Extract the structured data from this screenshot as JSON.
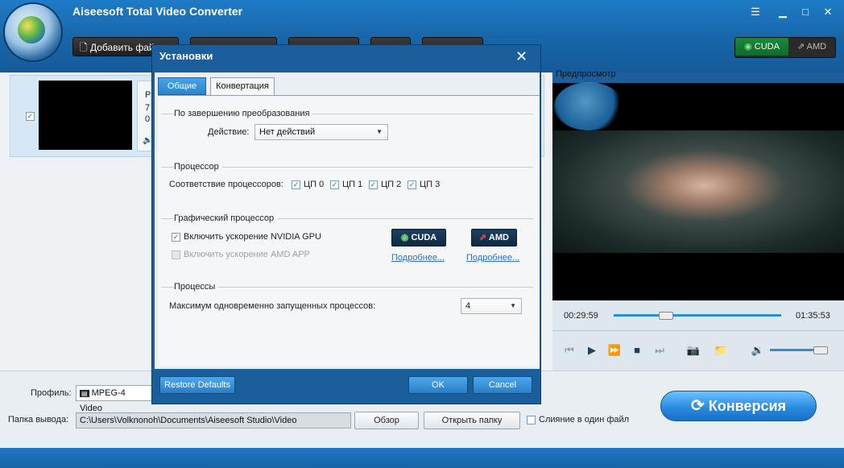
{
  "app": {
    "title": "Aiseesoft Total Video Converter"
  },
  "toolbar": {
    "add_file_label": "Добавить файл",
    "gpu_cuda": "CUDA",
    "gpu_amd": "AMD"
  },
  "file_item": {
    "line1": "P",
    "line2": "7",
    "line3": "0"
  },
  "preview": {
    "label": "Предпросмотр",
    "time_current": "00:29:59",
    "time_total": "01:35:53"
  },
  "bottom": {
    "profile_label": "Профиль:",
    "profile_value": "MPEG-4 Video",
    "output_label": "Папка вывода:",
    "output_path": "C:\\Users\\Volknonoh\\Documents\\Aiseesoft Studio\\Video",
    "browse_label": "Обзор",
    "open_folder_label": "Открыть папку",
    "merge_label": "Слияние в один файл",
    "convert_label": "Конверсия"
  },
  "dialog": {
    "title": "Установки",
    "tabs": [
      {
        "label": "Общие"
      },
      {
        "label": "Конвертация"
      }
    ],
    "after_conversion": {
      "group_title": "По завершению преобразования",
      "action_label": "Действие:",
      "action_value": "Нет действий"
    },
    "cpu": {
      "group_title": "Процессор",
      "affinity_label": "Соответствие процессоров:",
      "cores": [
        {
          "label": "ЦП 0"
        },
        {
          "label": "ЦП 1"
        },
        {
          "label": "ЦП 2"
        },
        {
          "label": "ЦП 3"
        }
      ]
    },
    "gpu": {
      "group_title": "Графический процессор",
      "nvidia_label": "Включить ускорение NVIDIA GPU",
      "amd_label": "Включить ускорение AMD APP",
      "cuda_badge": "CUDA",
      "amd_badge": "AMD",
      "more_link": "Подробнее..."
    },
    "processes": {
      "group_title": "Процессы",
      "max_label": "Максимум одновременно запущенных процессов:",
      "max_value": "4"
    },
    "restore_label": "Restore Defaults",
    "ok_label": "OK",
    "cancel_label": "Cancel"
  },
  "colors": {
    "accent": "#1a5f9c",
    "cuda_green": "#1a8a3a"
  }
}
